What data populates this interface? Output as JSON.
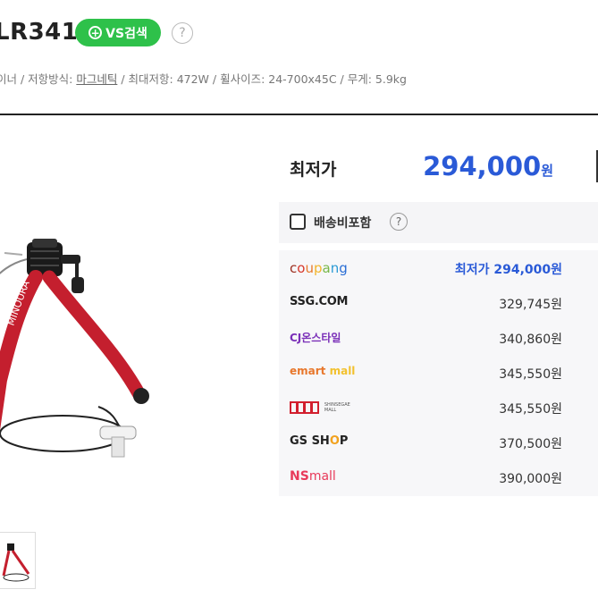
{
  "product": {
    "title": "LR341",
    "vs_search_label": "VS검색",
    "help_glyph": "?",
    "specs": {
      "part1": "이너 / 저항방식: ",
      "resistance": "마그네틱",
      "part2": " / 최대저항: 472W / 휠사이즈: 24-700x45C / 무게: 5.9kg"
    }
  },
  "pricing": {
    "lowest_label": "최저가",
    "lowest_price": "294,000",
    "unit": "원",
    "shipping_label": "배송비포함",
    "sellers": [
      {
        "logo": "coupang",
        "price": "294,000원",
        "best_prefix": "최저가 ",
        "best": true
      },
      {
        "logo": "SSG.COM",
        "price": "329,745원",
        "best": false
      },
      {
        "logo": "CJ온스타일",
        "price": "340,860원",
        "best": false
      },
      {
        "logo": "emart mall",
        "price": "345,550원",
        "best": false
      },
      {
        "logo": "SHINSEGAE MALL",
        "price": "345,550원",
        "best": false
      },
      {
        "logo": "GS SHOP",
        "price": "370,500원",
        "best": false
      },
      {
        "logo": "NS mall",
        "price": "390,000원",
        "best": false
      }
    ]
  },
  "colors": {
    "accent_blue": "#2a5ad7",
    "vs_green": "#2ec14a",
    "product_red": "#c41f2e"
  }
}
